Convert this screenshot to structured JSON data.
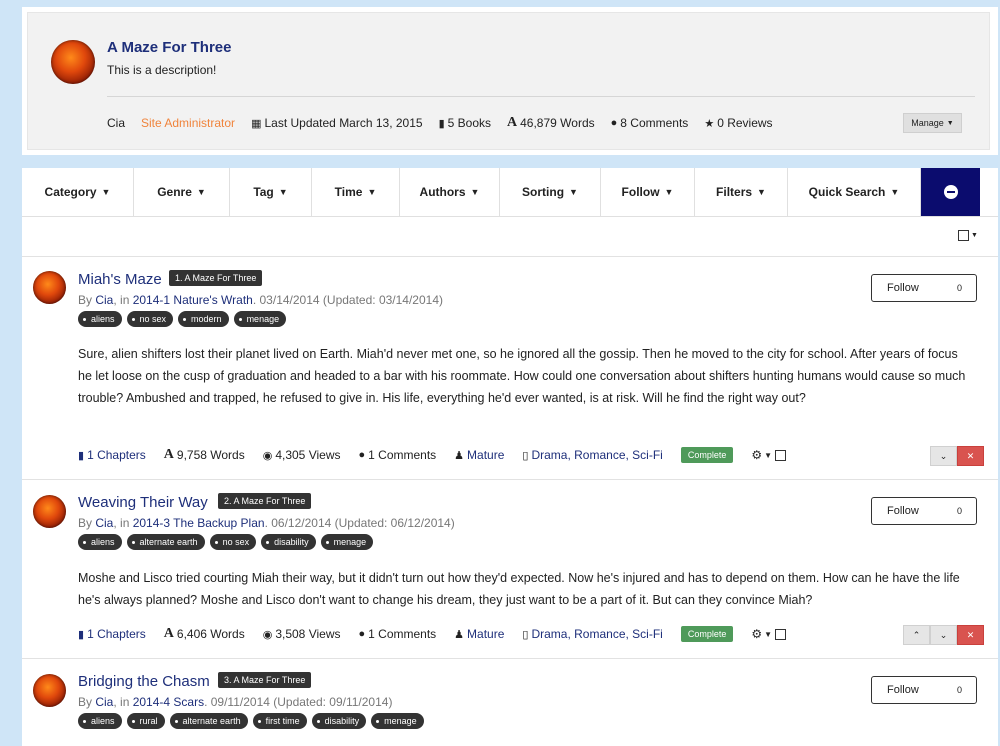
{
  "series": {
    "title": "A Maze For Three",
    "description": "This is a description!",
    "author": "Cia",
    "role": "Site Administrator",
    "last_updated": "Last Updated March 13, 2015",
    "books": "5 Books",
    "words": "46,879 Words",
    "comments": "8 Comments",
    "reviews": "0 Reviews",
    "manage_label": "Manage"
  },
  "nav": {
    "items": [
      {
        "label": "Category"
      },
      {
        "label": "Genre"
      },
      {
        "label": "Tag"
      },
      {
        "label": "Time"
      },
      {
        "label": "Authors"
      },
      {
        "label": "Sorting"
      },
      {
        "label": "Follow"
      },
      {
        "label": "Filters"
      },
      {
        "label": "Quick Search"
      }
    ]
  },
  "stories": [
    {
      "title": "Miah's Maze",
      "badge": "1. A Maze For Three",
      "by": "By ",
      "author": "Cia",
      "in": ", in ",
      "collection": "2014-1 Nature's Wrath",
      "dates": ". 03/14/2014 (Updated: 03/14/2014)",
      "tags": [
        "aliens",
        "no sex",
        "modern",
        "menage"
      ],
      "summary": "Sure, alien shifters lost their planet lived on Earth. Miah'd never met one, so he ignored all the gossip. Then he moved to the city for school. After years of focus he let loose on the cusp of graduation and headed to a bar with his roommate. How could one conversation about shifters hunting humans would cause so much trouble? Ambushed and trapped, he refused to give in. His life, everything he'd ever wanted, is at risk. Will he find the right way out?",
      "chapters": "1 Chapters",
      "words": "9,758 Words",
      "views": "4,305 Views",
      "comments": "1 Comments",
      "rating": "Mature",
      "genres": "Drama, Romance, Sci-Fi",
      "status": "Complete",
      "follow_label": "Follow",
      "follow_count": "0"
    },
    {
      "title": "Weaving Their Way",
      "badge": "2. A Maze For Three",
      "by": "By ",
      "author": "Cia",
      "in": ", in ",
      "collection": "2014-3 The Backup Plan",
      "dates": ". 06/12/2014 (Updated: 06/12/2014)",
      "tags": [
        "aliens",
        "alternate earth",
        "no sex",
        "disability",
        "menage"
      ],
      "summary": "Moshe and Lisco tried courting Miah their way, but it didn't turn out how they'd expected. Now he's injured and has to depend on them. How can he have the life he's always planned? Moshe and Lisco don't want to change his dream, they just want to be a part of it. But can they convince Miah?",
      "chapters": "1 Chapters",
      "words": "6,406 Words",
      "views": "3,508 Views",
      "comments": "1 Comments",
      "rating": "Mature",
      "genres": "Drama, Romance, Sci-Fi",
      "status": "Complete",
      "follow_label": "Follow",
      "follow_count": "0"
    },
    {
      "title": "Bridging the Chasm",
      "badge": "3. A Maze For Three",
      "by": "By ",
      "author": "Cia",
      "in": ", in ",
      "collection": "2014-4 Scars",
      "dates": ". 09/11/2014 (Updated: 09/11/2014)",
      "tags": [
        "aliens",
        "rural",
        "alternate earth",
        "first time",
        "disability",
        "menage"
      ],
      "follow_label": "Follow",
      "follow_count": "0"
    }
  ]
}
